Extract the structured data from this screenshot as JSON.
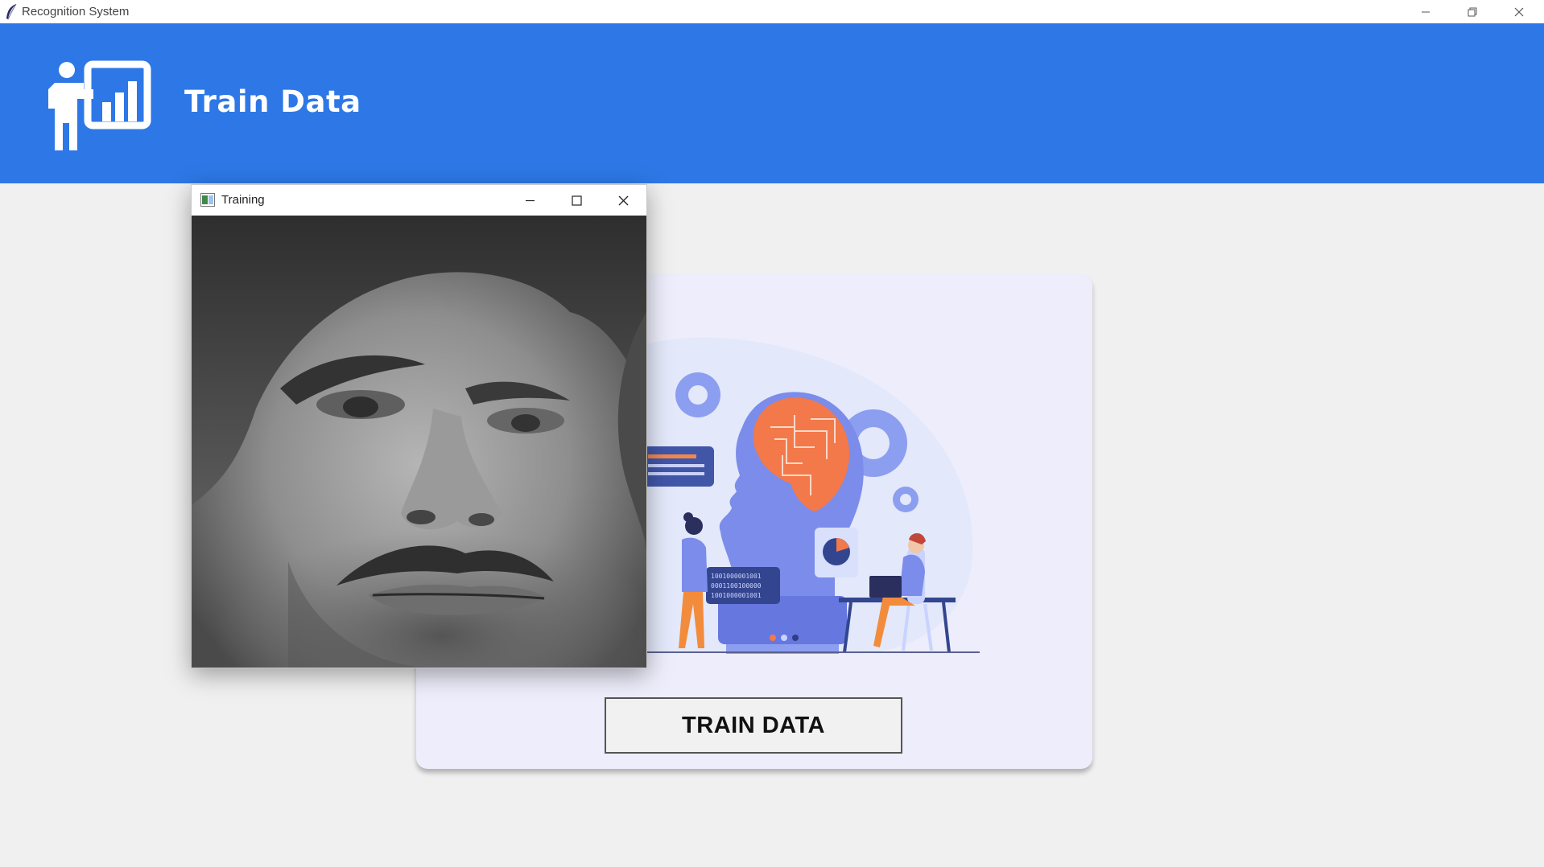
{
  "window": {
    "title": "Recognition System",
    "controls": [
      "minimize",
      "restore",
      "close"
    ]
  },
  "header": {
    "title": "Train Data",
    "logo_icon": "presentation-chart-icon",
    "background_color": "#2d78e6"
  },
  "card": {
    "illustration": "ai-brain-head-illustration",
    "illustration_code_text": [
      "1001000001001",
      "0001100100000",
      "1001000001001"
    ],
    "button_label": "TRAIN DATA"
  },
  "training_window": {
    "title": "Training",
    "icon": "image-window-icon",
    "content": "grayscale-face-capture"
  }
}
